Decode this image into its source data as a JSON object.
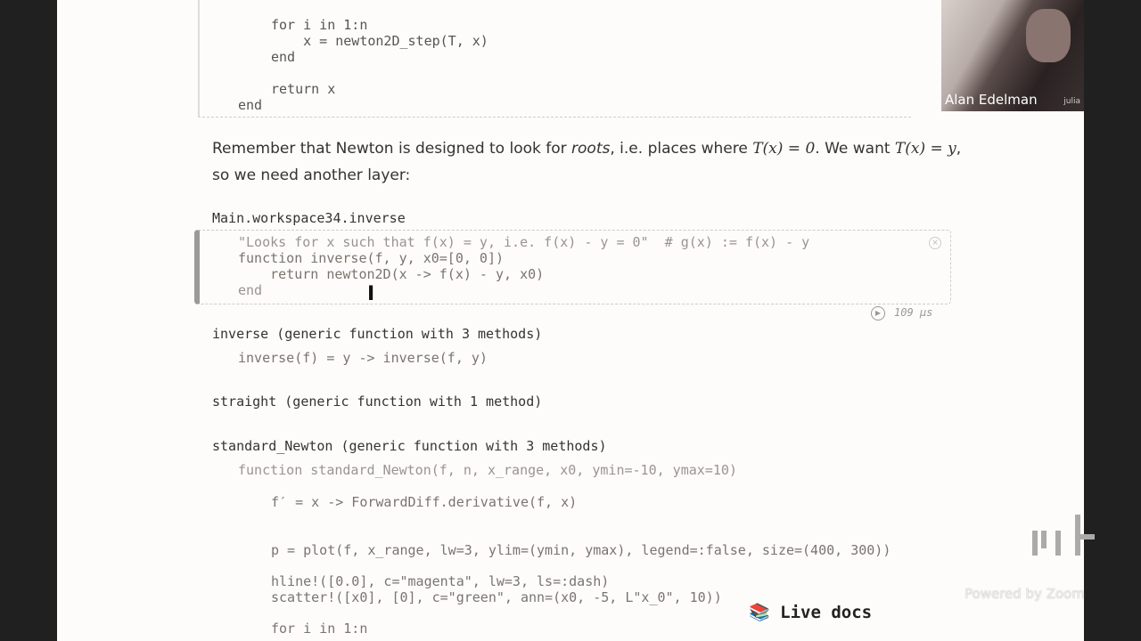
{
  "prev_cell": {
    "lines": [
      "for i in 1:n",
      "    x = newton2D_step(T, x)",
      "end",
      "return x",
      "end"
    ]
  },
  "prose": {
    "line1_a": "Remember that Newton is designed to look for ",
    "line1_em": "roots",
    "line1_b": ", i.e. places where ",
    "math1": "T(x) = 0",
    "line1_c": ". We want ",
    "math2": "T(x) = y",
    "line1_d": ",",
    "line2": "so we need another layer:"
  },
  "inverse_cell": {
    "output": "Main.workspace34.inverse",
    "code": [
      "\"Looks for x such that f(x) = y, i.e. f(x) - y = 0\"  # g(x) := f(x) - y",
      "function inverse(f, y, x0=[0, 0])",
      "    return newton2D(x -> f(x) - y, x0)",
      "end"
    ],
    "runtime": "109 μs"
  },
  "cells": [
    {
      "output": "inverse (generic function with 3 methods)",
      "code": "inverse(f) = y -> inverse(f, y)"
    },
    {
      "output": "straight (generic function with 1 method)"
    },
    {
      "output": "standard_Newton (generic function with 3 methods)",
      "code": [
        "function standard_Newton(f, n, x_range, x0, ymin=-10, ymax=10)",
        "f′ = x -> ForwardDiff.derivative(f, x)",
        "p = plot(f, x_range, lw=3, ylim=(ymin, ymax), legend=:false, size=(400, 300))",
        "hline!([0.0], c=\"magenta\", lw=3, ls=:dash)",
        "scatter!([x0], [0], c=\"green\", ann=(x0, -5, L\"x_0\", 10))",
        "for i in 1:n"
      ]
    }
  ],
  "live_docs": "Live docs",
  "webcam": {
    "name": "Alan Edelman",
    "shirt_logo": "julia"
  },
  "watermark": "Powered by Zoom"
}
